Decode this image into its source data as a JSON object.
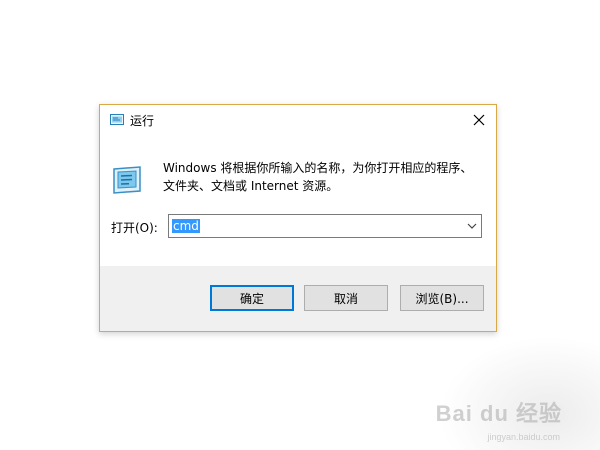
{
  "window": {
    "title": "运行",
    "close_label": "×"
  },
  "dialog": {
    "description_line1": "Windows 将根据你所输入的名称，为你打开相应的程序、",
    "description_line2": "文件夹、文档或 Internet 资源。",
    "open_label": "打开(O):",
    "input_value": "cmd"
  },
  "buttons": {
    "ok_label": "确定",
    "cancel_label": "取消",
    "browse_label": "浏览(B)..."
  },
  "watermark": {
    "text": "Bai du 经验",
    "sub": "jingyan.baidu.com"
  },
  "colors": {
    "window_border": "#d9a948",
    "focus_blue": "#0078d7",
    "selection_blue": "#3399ff"
  },
  "icons": {
    "title": "run-icon",
    "body": "run-large-icon",
    "close": "close-icon",
    "dropdown": "chevron-down-icon"
  }
}
